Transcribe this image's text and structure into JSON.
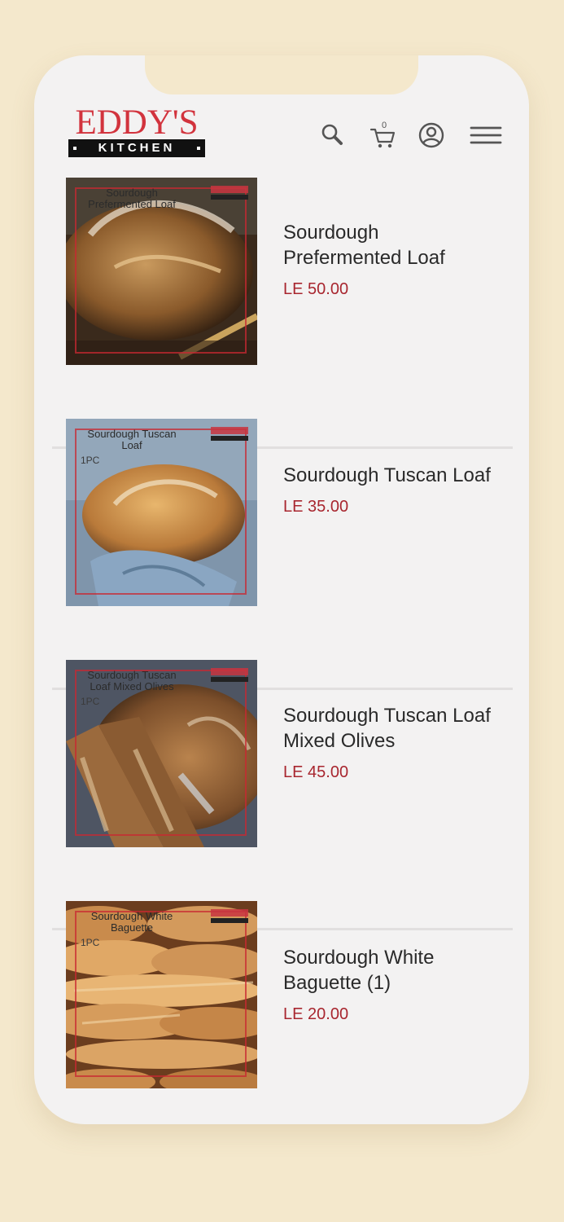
{
  "brand": {
    "logo_top": "EDDY'S",
    "logo_bottom": "KITCHEN",
    "primary_color": "#d2333d"
  },
  "header": {
    "cart_count": "0",
    "icons": [
      "search-icon",
      "cart-icon",
      "user-icon",
      "menu-icon"
    ]
  },
  "products": [
    {
      "name": "Sourdough Prefermented Loaf",
      "price": "LE 50.00",
      "image_label": "Sourdough Prefermented Loaf",
      "image_badge": ""
    },
    {
      "name": "Sourdough Tuscan Loaf",
      "price": "LE 35.00",
      "image_label": "Sourdough Tuscan Loaf",
      "image_badge": "1PC"
    },
    {
      "name": "Sourdough Tuscan Loaf Mixed Olives",
      "price": "LE 45.00",
      "image_label": "Sourdough Tuscan Loaf Mixed Olives",
      "image_badge": "1PC"
    },
    {
      "name": "Sourdough White Baguette (1)",
      "price": "LE 20.00",
      "image_label": "Sourdough White Baguette",
      "image_badge": "1PC"
    }
  ],
  "colors": {
    "background": "#f4e8cc",
    "card": "#f3f2f2",
    "price": "#a8262f",
    "text": "#2a2a2a"
  }
}
